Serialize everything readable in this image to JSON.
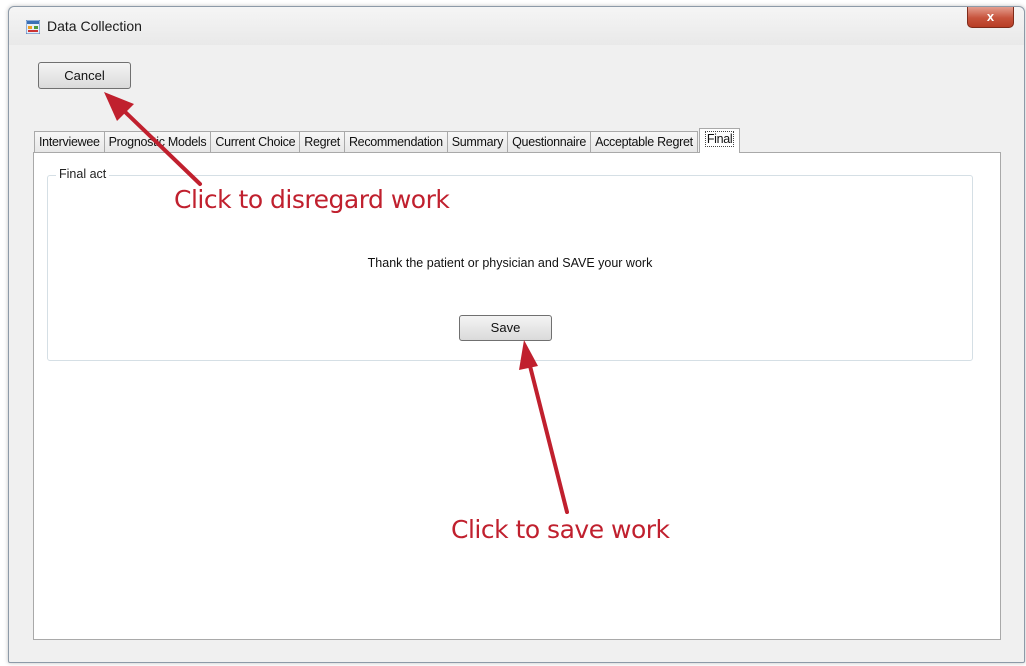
{
  "window": {
    "title": "Data Collection",
    "close_glyph": "x",
    "app_icon": "form-window-icon"
  },
  "toolbar": {
    "cancel_label": "Cancel"
  },
  "tabs": [
    {
      "label": "Interviewee"
    },
    {
      "label": "Prognostic Models"
    },
    {
      "label": "Current Choice"
    },
    {
      "label": "Regret"
    },
    {
      "label": "Recommendation"
    },
    {
      "label": "Summary"
    },
    {
      "label": "Questionnaire"
    },
    {
      "label": "Acceptable Regret"
    },
    {
      "label": "Final",
      "active": true
    }
  ],
  "final_panel": {
    "group_label": "Final act",
    "message": "Thank the patient or physician and SAVE your work",
    "save_label": "Save"
  },
  "annotations": {
    "cancel_note": "Click to disregard work",
    "save_note": "Click to save work",
    "color": "#c0202e"
  }
}
